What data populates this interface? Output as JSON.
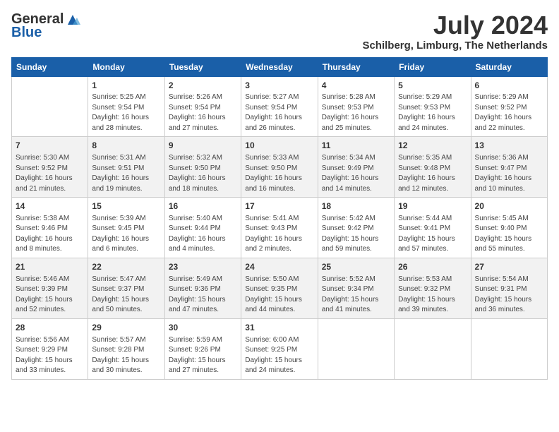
{
  "header": {
    "logo_general": "General",
    "logo_blue": "Blue",
    "month_year": "July 2024",
    "location": "Schilberg, Limburg, The Netherlands"
  },
  "columns": [
    "Sunday",
    "Monday",
    "Tuesday",
    "Wednesday",
    "Thursday",
    "Friday",
    "Saturday"
  ],
  "weeks": [
    [
      {
        "day": "",
        "info": ""
      },
      {
        "day": "1",
        "info": "Sunrise: 5:25 AM\nSunset: 9:54 PM\nDaylight: 16 hours\nand 28 minutes."
      },
      {
        "day": "2",
        "info": "Sunrise: 5:26 AM\nSunset: 9:54 PM\nDaylight: 16 hours\nand 27 minutes."
      },
      {
        "day": "3",
        "info": "Sunrise: 5:27 AM\nSunset: 9:54 PM\nDaylight: 16 hours\nand 26 minutes."
      },
      {
        "day": "4",
        "info": "Sunrise: 5:28 AM\nSunset: 9:53 PM\nDaylight: 16 hours\nand 25 minutes."
      },
      {
        "day": "5",
        "info": "Sunrise: 5:29 AM\nSunset: 9:53 PM\nDaylight: 16 hours\nand 24 minutes."
      },
      {
        "day": "6",
        "info": "Sunrise: 5:29 AM\nSunset: 9:52 PM\nDaylight: 16 hours\nand 22 minutes."
      }
    ],
    [
      {
        "day": "7",
        "info": "Sunrise: 5:30 AM\nSunset: 9:52 PM\nDaylight: 16 hours\nand 21 minutes."
      },
      {
        "day": "8",
        "info": "Sunrise: 5:31 AM\nSunset: 9:51 PM\nDaylight: 16 hours\nand 19 minutes."
      },
      {
        "day": "9",
        "info": "Sunrise: 5:32 AM\nSunset: 9:50 PM\nDaylight: 16 hours\nand 18 minutes."
      },
      {
        "day": "10",
        "info": "Sunrise: 5:33 AM\nSunset: 9:50 PM\nDaylight: 16 hours\nand 16 minutes."
      },
      {
        "day": "11",
        "info": "Sunrise: 5:34 AM\nSunset: 9:49 PM\nDaylight: 16 hours\nand 14 minutes."
      },
      {
        "day": "12",
        "info": "Sunrise: 5:35 AM\nSunset: 9:48 PM\nDaylight: 16 hours\nand 12 minutes."
      },
      {
        "day": "13",
        "info": "Sunrise: 5:36 AM\nSunset: 9:47 PM\nDaylight: 16 hours\nand 10 minutes."
      }
    ],
    [
      {
        "day": "14",
        "info": "Sunrise: 5:38 AM\nSunset: 9:46 PM\nDaylight: 16 hours\nand 8 minutes."
      },
      {
        "day": "15",
        "info": "Sunrise: 5:39 AM\nSunset: 9:45 PM\nDaylight: 16 hours\nand 6 minutes."
      },
      {
        "day": "16",
        "info": "Sunrise: 5:40 AM\nSunset: 9:44 PM\nDaylight: 16 hours\nand 4 minutes."
      },
      {
        "day": "17",
        "info": "Sunrise: 5:41 AM\nSunset: 9:43 PM\nDaylight: 16 hours\nand 2 minutes."
      },
      {
        "day": "18",
        "info": "Sunrise: 5:42 AM\nSunset: 9:42 PM\nDaylight: 15 hours\nand 59 minutes."
      },
      {
        "day": "19",
        "info": "Sunrise: 5:44 AM\nSunset: 9:41 PM\nDaylight: 15 hours\nand 57 minutes."
      },
      {
        "day": "20",
        "info": "Sunrise: 5:45 AM\nSunset: 9:40 PM\nDaylight: 15 hours\nand 55 minutes."
      }
    ],
    [
      {
        "day": "21",
        "info": "Sunrise: 5:46 AM\nSunset: 9:39 PM\nDaylight: 15 hours\nand 52 minutes."
      },
      {
        "day": "22",
        "info": "Sunrise: 5:47 AM\nSunset: 9:37 PM\nDaylight: 15 hours\nand 50 minutes."
      },
      {
        "day": "23",
        "info": "Sunrise: 5:49 AM\nSunset: 9:36 PM\nDaylight: 15 hours\nand 47 minutes."
      },
      {
        "day": "24",
        "info": "Sunrise: 5:50 AM\nSunset: 9:35 PM\nDaylight: 15 hours\nand 44 minutes."
      },
      {
        "day": "25",
        "info": "Sunrise: 5:52 AM\nSunset: 9:34 PM\nDaylight: 15 hours\nand 41 minutes."
      },
      {
        "day": "26",
        "info": "Sunrise: 5:53 AM\nSunset: 9:32 PM\nDaylight: 15 hours\nand 39 minutes."
      },
      {
        "day": "27",
        "info": "Sunrise: 5:54 AM\nSunset: 9:31 PM\nDaylight: 15 hours\nand 36 minutes."
      }
    ],
    [
      {
        "day": "28",
        "info": "Sunrise: 5:56 AM\nSunset: 9:29 PM\nDaylight: 15 hours\nand 33 minutes."
      },
      {
        "day": "29",
        "info": "Sunrise: 5:57 AM\nSunset: 9:28 PM\nDaylight: 15 hours\nand 30 minutes."
      },
      {
        "day": "30",
        "info": "Sunrise: 5:59 AM\nSunset: 9:26 PM\nDaylight: 15 hours\nand 27 minutes."
      },
      {
        "day": "31",
        "info": "Sunrise: 6:00 AM\nSunset: 9:25 PM\nDaylight: 15 hours\nand 24 minutes."
      },
      {
        "day": "",
        "info": ""
      },
      {
        "day": "",
        "info": ""
      },
      {
        "day": "",
        "info": ""
      }
    ]
  ]
}
